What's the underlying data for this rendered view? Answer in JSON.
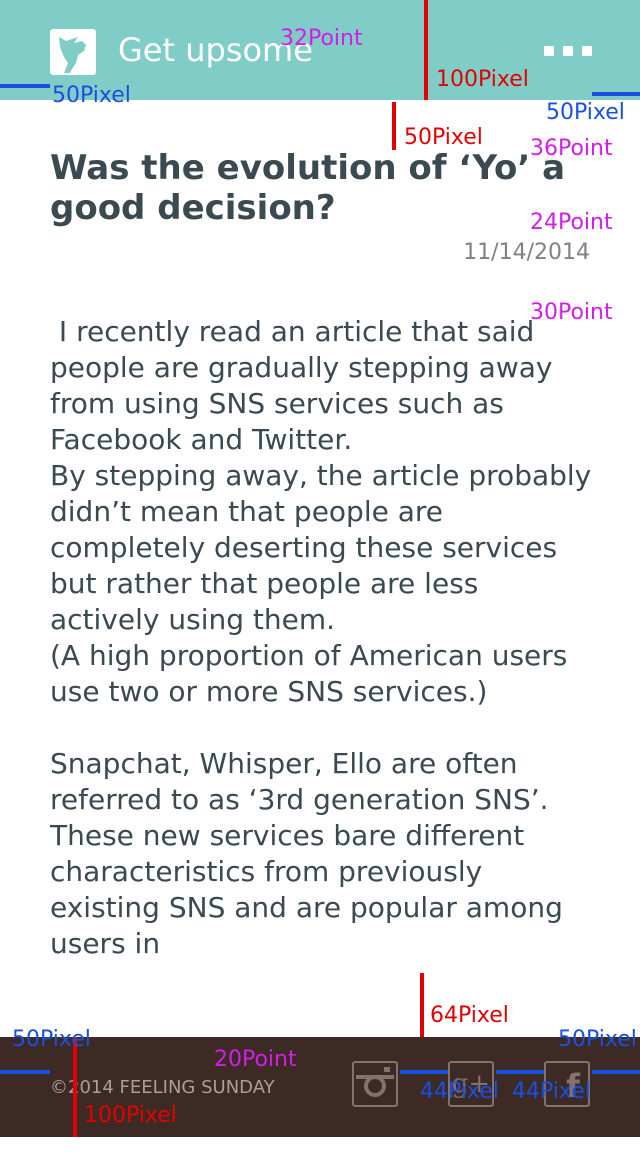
{
  "header": {
    "app_title": "Get upsome",
    "logo": "goat-head-logo",
    "menu_icon": "more-dots-icon",
    "color": "#80ccc6"
  },
  "article": {
    "title": "Was the evolution of ‘Yo’ a good decision?",
    "date": "11/14/2014",
    "paragraphs": [
      " I recently read an article that said people are gradually stepping away from using SNS services such as Facebook and Twitter.",
      "By stepping away, the article probably didn’t mean that people are completely deserting these services but rather that people are less actively using them.",
      "(A high proportion of American users use two or more SNS services.)",
      "Snapchat, Whisper, Ello are often referred to as ‘3rd generation SNS’. These new services bare different characteristics from previously existing SNS and are popular among users in"
    ]
  },
  "footer": {
    "copyright": "©2014 FEELING SUNDAY",
    "color": "#3d2a24",
    "social": [
      {
        "icon": "instagram-icon"
      },
      {
        "icon": "google-plus-icon",
        "glyph": "g+"
      },
      {
        "icon": "facebook-icon",
        "glyph": "f"
      }
    ]
  },
  "annotations": {
    "header_title_size": "32Point",
    "header_height": "100Pixel",
    "header_left_margin": "50Pixel",
    "header_right_margin": "50Pixel",
    "title_top_gap": "50Pixel",
    "title_size": "36Point",
    "date_size": "24Point",
    "body_size": "30Point",
    "footer_gap": "64Pixel",
    "footer_left_margin": "50Pixel",
    "footer_right_margin": "50Pixel",
    "copyright_size": "20Point",
    "footer_height": "100Pixel",
    "icon_spacing_1": "44Pixel",
    "icon_spacing_2": "44Pixel"
  }
}
